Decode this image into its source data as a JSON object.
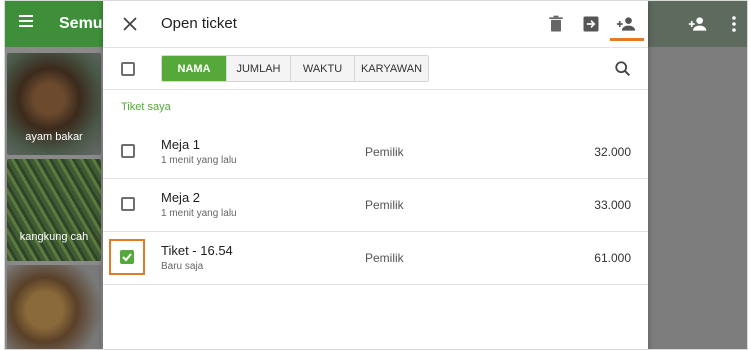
{
  "background": {
    "title": "Semua",
    "items": [
      {
        "label": "ayam bakar"
      },
      {
        "label": "kangkung cah"
      },
      {
        "label": ""
      }
    ]
  },
  "dialog": {
    "title": "Open ticket",
    "tabs": [
      {
        "label": "NAMA",
        "active": true
      },
      {
        "label": "JUMLAH",
        "active": false
      },
      {
        "label": "WAKTU",
        "active": false
      },
      {
        "label": "KARYAWAN",
        "active": false
      }
    ],
    "section_label": "Tiket saya",
    "tickets": [
      {
        "name": "Meja 1",
        "time": "1 menit yang lalu",
        "owner": "Pemilik",
        "amount": "32.000",
        "checked": false
      },
      {
        "name": "Meja 2",
        "time": "1 menit yang lalu",
        "owner": "Pemilik",
        "amount": "33.000",
        "checked": false
      },
      {
        "name": "Tiket - 16.54",
        "time": "Baru saja",
        "owner": "Pemilik",
        "amount": "61.000",
        "checked": true
      }
    ]
  },
  "colors": {
    "accent_green": "#55a93b",
    "header_green": "#3f8f3a",
    "highlight_orange": "#e07b27"
  },
  "icons": [
    "menu-icon",
    "close-icon",
    "trash-icon",
    "move-icon",
    "add-person-icon",
    "search-icon",
    "more-vert-icon"
  ]
}
